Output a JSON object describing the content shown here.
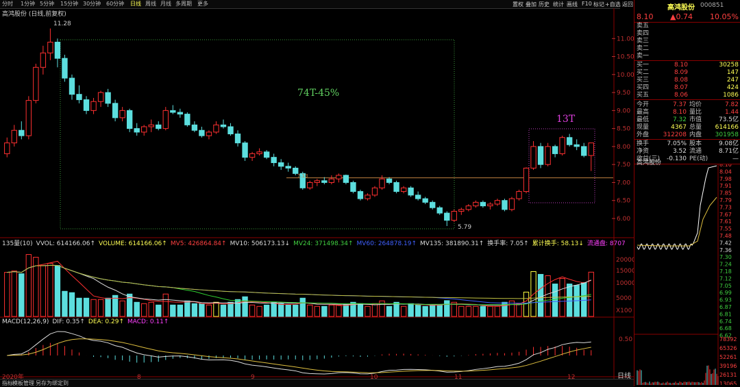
{
  "toolbar": {
    "tabs": [
      "分时",
      "1分钟",
      "5分钟",
      "15分钟",
      "30分钟",
      "60分钟",
      "日线",
      "周线",
      "月线",
      "多周期",
      "更多"
    ],
    "active_tab": "日线",
    "right_buttons": [
      "置权",
      "叠加",
      "历史",
      "统计",
      "画线",
      "F10",
      "标记",
      "+自选",
      "返回"
    ]
  },
  "chart": {
    "title": "高鸿股份 (日线,前复权)",
    "high_label": "11.28",
    "low_label": "5.79",
    "annotation_left": "74T-45%",
    "annotation_right": "13T",
    "price_line_label": "7.13",
    "y_ticks": [
      "11.00",
      "10.50",
      "10.00",
      "9.50",
      "9.00",
      "8.50",
      "8.00",
      "7.50",
      "7.00",
      "6.50",
      "6.00"
    ],
    "x_labels": [
      "2020年",
      "8",
      "9",
      "10",
      "11",
      "12"
    ],
    "period_label": "日线"
  },
  "volume_header": {
    "label": "135量(10)",
    "vvol": "VVOL: 614166.06↑",
    "volume": "VOLUME: 614166.06↑",
    "mv5": "MV5: 426864.84↑",
    "mv10": "MV10: 506173.13↓",
    "mv24": "MV24: 371498.34↑",
    "mv60": "MV60: 264878.19↑",
    "mv135": "MV135: 381890.31↑",
    "turnover": "换手率: 7.05↑",
    "cum_turnover": "累计换手: 58.13↓",
    "float": "流通盘: 8707",
    "y_ticks": [
      "20000",
      "15000",
      "10000",
      "5000",
      "X100"
    ]
  },
  "macd_header": {
    "label": "MACD(12,26,9)",
    "dif": "DIF: 0.35↑",
    "dea": "DEA: 0.29↑",
    "macd": "MACD: 0.11↑",
    "y_tick": "0.50"
  },
  "bottom_tabs": [
    "指标",
    "模板",
    "管理",
    "另存为",
    "绑定到"
  ],
  "right_panel": {
    "name": "高鸿股份",
    "code": "000851",
    "price": "8.10",
    "change": "▲0.74",
    "change_pct": "10.05%",
    "sell": [
      {
        "label": "卖五",
        "price": "",
        "vol": ""
      },
      {
        "label": "卖四",
        "price": "",
        "vol": ""
      },
      {
        "label": "卖三",
        "price": "",
        "vol": ""
      },
      {
        "label": "卖二",
        "price": "",
        "vol": ""
      },
      {
        "label": "卖一",
        "price": "",
        "vol": ""
      }
    ],
    "buy": [
      {
        "label": "买一",
        "price": "8.10",
        "vol": "30258"
      },
      {
        "label": "买二",
        "price": "8.09",
        "vol": "147"
      },
      {
        "label": "买三",
        "price": "8.08",
        "vol": "247"
      },
      {
        "label": "买四",
        "price": "8.07",
        "vol": "424"
      },
      {
        "label": "买五",
        "price": "8.06",
        "vol": "1086"
      }
    ],
    "stats": [
      {
        "l1": "今开",
        "v1": "7.37",
        "l2": "均价",
        "v2": "7.82"
      },
      {
        "l1": "最高",
        "v1": "8.10",
        "l2": "量比",
        "v2": "1.44"
      },
      {
        "l1": "最低",
        "v1": "7.32",
        "l2": "市值",
        "v2": "73.5亿"
      },
      {
        "l1": "现量",
        "v1": "4367",
        "l2": "总量",
        "v2": "614166"
      },
      {
        "l1": "外盘",
        "v1": "312208",
        "l2": "内盘",
        "v2": "301958"
      }
    ],
    "stats2": [
      {
        "l1": "换手",
        "v1": "7.05%",
        "l2": "股本",
        "v2": "9.08亿"
      },
      {
        "l1": "净资",
        "v1": "3.52",
        "l2": "流通",
        "v2": "8.71亿"
      },
      {
        "l1": "收益(三)",
        "v1": "-0.130",
        "l2": "PE(动)",
        "v2": "—"
      }
    ],
    "mini_title": "高鸿股份",
    "mini_price_ticks": [
      "8.10",
      "8.04",
      "7.98",
      "7.91",
      "7.85",
      "7.79",
      "7.73",
      "7.67",
      "7.61",
      "7.55",
      "7.48",
      "7.42",
      "7.36",
      "7.30",
      "7.24",
      "7.18",
      "7.12",
      "7.05",
      "6.99",
      "6.93",
      "6.87",
      "6.81",
      "6.74",
      "6.68",
      "6.62"
    ],
    "mini_vol_ticks": [
      "78392",
      "65326",
      "52261",
      "39196",
      "26131",
      "13065"
    ]
  },
  "chart_data": {
    "type": "candlestick",
    "note_series": "approx daily OHLC",
    "ohlc": [
      [
        7.8,
        8.25,
        7.7,
        8.1
      ],
      [
        8.1,
        8.6,
        8.0,
        8.45
      ],
      [
        8.45,
        8.7,
        8.2,
        8.3
      ],
      [
        8.3,
        9.4,
        8.2,
        9.28
      ],
      [
        9.28,
        10.3,
        9.2,
        10.2
      ],
      [
        10.2,
        10.8,
        10.0,
        10.6
      ],
      [
        10.6,
        11.28,
        10.4,
        10.9
      ],
      [
        10.9,
        11.0,
        10.2,
        10.45
      ],
      [
        10.45,
        10.55,
        9.8,
        9.9
      ],
      [
        9.9,
        10.0,
        9.3,
        9.45
      ],
      [
        9.45,
        9.7,
        9.2,
        9.3
      ],
      [
        9.3,
        9.4,
        8.9,
        9.0
      ],
      [
        9.0,
        9.35,
        8.9,
        9.25
      ],
      [
        9.25,
        9.55,
        9.1,
        9.5
      ],
      [
        9.5,
        9.6,
        9.1,
        9.2
      ],
      [
        9.2,
        9.3,
        8.7,
        8.8
      ],
      [
        8.8,
        9.1,
        8.7,
        9.0
      ],
      [
        9.0,
        9.05,
        8.4,
        8.5
      ],
      [
        8.5,
        8.65,
        8.3,
        8.4
      ],
      [
        8.4,
        8.6,
        8.3,
        8.55
      ],
      [
        8.55,
        8.75,
        8.4,
        8.6
      ],
      [
        8.6,
        8.7,
        8.45,
        8.5
      ],
      [
        8.5,
        9.1,
        8.45,
        9.0
      ],
      [
        9.0,
        9.15,
        8.9,
        8.95
      ],
      [
        8.95,
        9.05,
        8.8,
        8.9
      ],
      [
        8.9,
        8.95,
        8.55,
        8.6
      ],
      [
        8.6,
        8.7,
        8.4,
        8.45
      ],
      [
        8.45,
        8.55,
        8.25,
        8.3
      ],
      [
        8.3,
        8.45,
        8.2,
        8.4
      ],
      [
        8.4,
        8.7,
        8.35,
        8.6
      ],
      [
        8.6,
        8.75,
        8.5,
        8.55
      ],
      [
        8.55,
        8.65,
        8.3,
        8.35
      ],
      [
        8.35,
        8.45,
        8.0,
        8.1
      ],
      [
        8.1,
        8.15,
        7.6,
        7.7
      ],
      [
        7.7,
        7.85,
        7.6,
        7.8
      ],
      [
        7.8,
        7.95,
        7.75,
        7.85
      ],
      [
        7.85,
        7.9,
        7.65,
        7.7
      ],
      [
        7.7,
        7.8,
        7.45,
        7.55
      ],
      [
        7.55,
        7.65,
        7.35,
        7.45
      ],
      [
        7.45,
        7.55,
        7.3,
        7.4
      ],
      [
        7.4,
        7.45,
        7.2,
        7.25
      ],
      [
        7.25,
        7.3,
        6.8,
        6.85
      ],
      [
        6.85,
        7.05,
        6.8,
        7.0
      ],
      [
        7.0,
        7.1,
        6.9,
        7.05
      ],
      [
        7.05,
        7.15,
        6.95,
        7.0
      ],
      [
        7.0,
        7.2,
        6.95,
        7.1
      ],
      [
        7.1,
        7.25,
        7.0,
        7.2
      ],
      [
        7.2,
        7.22,
        6.95,
        7.0
      ],
      [
        7.0,
        7.05,
        6.7,
        6.75
      ],
      [
        6.75,
        6.8,
        6.5,
        6.55
      ],
      [
        6.55,
        6.7,
        6.5,
        6.65
      ],
      [
        6.65,
        6.9,
        6.6,
        6.85
      ],
      [
        6.85,
        7.2,
        6.8,
        7.1
      ],
      [
        7.1,
        7.15,
        6.95,
        7.0
      ],
      [
        7.0,
        7.05,
        6.7,
        6.75
      ],
      [
        6.75,
        6.9,
        6.7,
        6.85
      ],
      [
        6.85,
        6.9,
        6.6,
        6.65
      ],
      [
        6.65,
        6.75,
        6.5,
        6.55
      ],
      [
        6.55,
        6.6,
        6.4,
        6.45
      ],
      [
        6.45,
        6.5,
        6.25,
        6.3
      ],
      [
        6.3,
        6.35,
        6.1,
        6.15
      ],
      [
        6.15,
        6.2,
        5.79,
        5.95
      ],
      [
        5.95,
        6.25,
        5.9,
        6.2
      ],
      [
        6.2,
        6.3,
        6.1,
        6.25
      ],
      [
        6.25,
        6.4,
        6.2,
        6.35
      ],
      [
        6.35,
        6.5,
        6.3,
        6.45
      ],
      [
        6.45,
        6.5,
        6.3,
        6.35
      ],
      [
        6.35,
        6.45,
        6.25,
        6.4
      ],
      [
        6.4,
        6.55,
        6.35,
        6.5
      ],
      [
        6.5,
        6.55,
        6.2,
        6.25
      ],
      [
        6.25,
        6.6,
        6.2,
        6.55
      ],
      [
        6.55,
        6.8,
        6.5,
        6.75
      ],
      [
        6.75,
        7.42,
        6.7,
        7.4
      ],
      [
        7.4,
        8.15,
        7.35,
        8.0
      ],
      [
        8.0,
        8.1,
        7.4,
        7.5
      ],
      [
        7.5,
        8.1,
        7.45,
        8.0
      ],
      [
        8.0,
        8.05,
        7.7,
        7.8
      ],
      [
        7.8,
        8.3,
        7.75,
        8.25
      ],
      [
        8.25,
        8.35,
        8.0,
        8.05
      ],
      [
        8.05,
        8.2,
        7.9,
        8.0
      ],
      [
        8.0,
        8.1,
        7.7,
        7.75
      ],
      [
        7.75,
        8.1,
        7.32,
        8.1
      ]
    ],
    "y_range": [
      5.6,
      11.5
    ]
  }
}
